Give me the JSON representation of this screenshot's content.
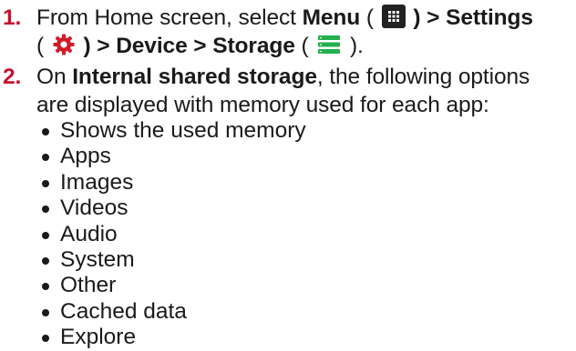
{
  "steps": [
    {
      "number": "1.",
      "line1_pre": "From Home screen, select ",
      "menu_label": "Menu",
      "paren_open": "(",
      "paren_close_sep": ") > ",
      "settings_label": "Settings",
      "line2_paren_open": "(",
      "line2_sep": ") > ",
      "device_label": "Device",
      "arrow": " > ",
      "storage_label": "Storage",
      "paren_close": ")."
    },
    {
      "number": "2.",
      "pre": "On ",
      "internal_label": "Internal shared storage",
      "post": ", the following options",
      "line2": "are displayed with memory used for each app:"
    }
  ],
  "options": [
    "Shows the used memory",
    "Apps",
    "Images",
    "Videos",
    "Audio",
    "System",
    "Other",
    "Cached data",
    "Explore"
  ],
  "icons": {
    "menu": "menu-grid-icon",
    "settings": "settings-gear-icon",
    "storage": "storage-icon"
  },
  "colors": {
    "step_number": "#c8102e",
    "gear": "#d11a2a",
    "storage": "#22b14c",
    "menu_icon_bg": "#222222"
  }
}
